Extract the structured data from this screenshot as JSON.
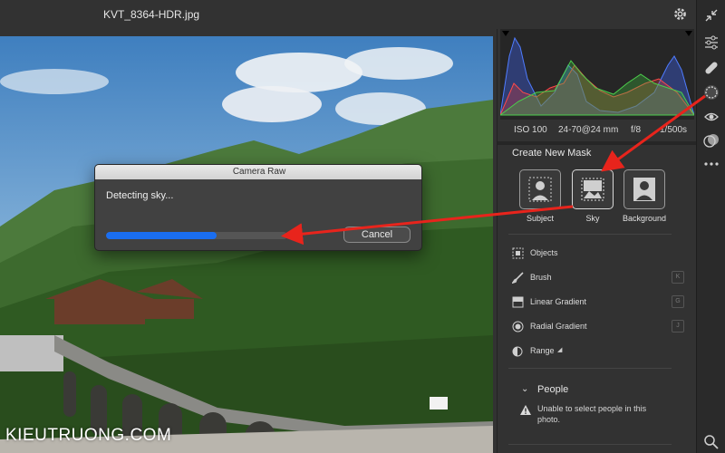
{
  "window": {
    "title": "KVT_8364-HDR.jpg"
  },
  "histogram": {
    "exif": {
      "iso": "ISO 100",
      "lens": "24-70@24 mm",
      "aperture": "f/8",
      "shutter": "1/500s"
    }
  },
  "mask_panel": {
    "heading": "Create New Mask",
    "buttons": [
      {
        "label": "Subject",
        "icon": "subject-mask-icon"
      },
      {
        "label": "Sky",
        "icon": "sky-mask-icon"
      },
      {
        "label": "Background",
        "icon": "background-mask-icon"
      }
    ],
    "tools": [
      {
        "label": "Objects",
        "icon": "objects-icon",
        "key": ""
      },
      {
        "label": "Brush",
        "icon": "brush-icon",
        "key": "K"
      },
      {
        "label": "Linear Gradient",
        "icon": "linear-gradient-icon",
        "key": "G"
      },
      {
        "label": "Radial Gradient",
        "icon": "radial-gradient-icon",
        "key": "J"
      },
      {
        "label": "Range",
        "icon": "range-icon",
        "key": ""
      }
    ],
    "people": {
      "label": "People",
      "warning": "Unable to select people in this photo."
    }
  },
  "dialog": {
    "title": "Camera Raw",
    "message": "Detecting sky...",
    "progress": 0.61,
    "cancel_label": "Cancel"
  },
  "watermark": "KIEUTRUONG.COM",
  "colors": {
    "progress": "#1a6ef0",
    "arrow": "#e8241c"
  }
}
